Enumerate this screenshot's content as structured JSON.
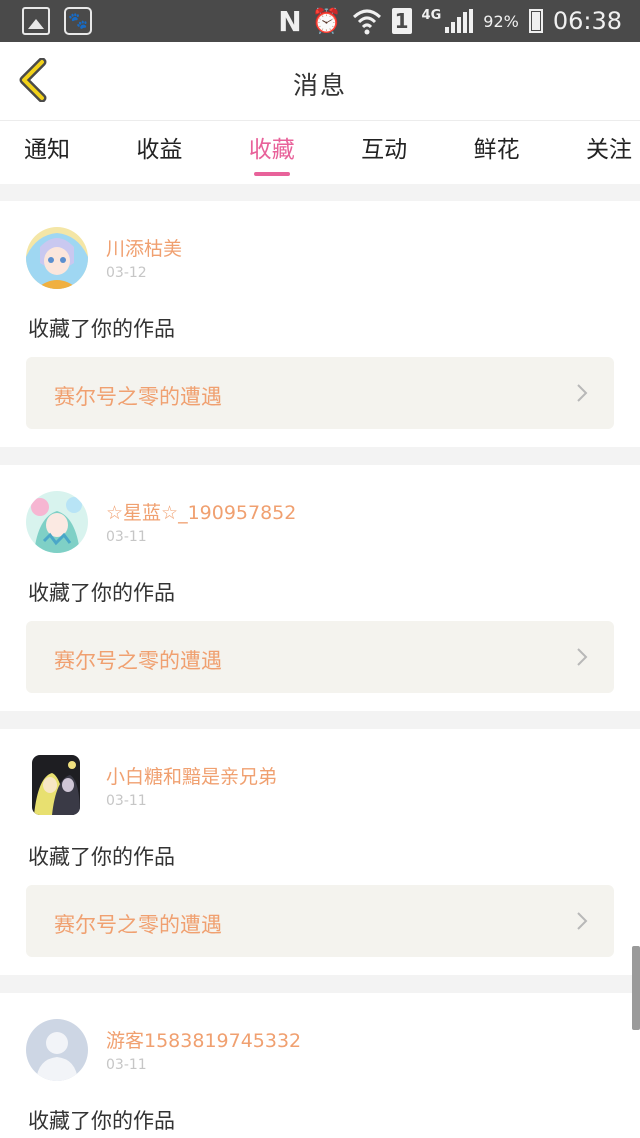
{
  "status_bar": {
    "left_icons": [
      "gallery-icon",
      "paw-icon"
    ],
    "network_letter": "N",
    "sim_slot": "1",
    "network_type": "4G",
    "battery_percent": "92%",
    "time": "06:38"
  },
  "header": {
    "title": "消息",
    "back_icon": "chevron-left-icon"
  },
  "tabs": [
    {
      "label": "通知",
      "active": false
    },
    {
      "label": "收益",
      "active": false
    },
    {
      "label": "收藏",
      "active": true
    },
    {
      "label": "互动",
      "active": false
    },
    {
      "label": "鲜花",
      "active": false
    },
    {
      "label": "关注",
      "active": false
    }
  ],
  "colors": {
    "accent": "#e8629a",
    "name_orange": "#f0a070",
    "work_bg": "#f4f3ee"
  },
  "messages": [
    {
      "username": "川添枯美",
      "date": "03-12",
      "action": "收藏了你的作品",
      "work_title": "赛尔号之零的遭遇"
    },
    {
      "username": "☆星蓝☆_190957852",
      "date": "03-11",
      "action": "收藏了你的作品",
      "work_title": "赛尔号之零的遭遇"
    },
    {
      "username": "小白糖和黯是亲兄弟",
      "date": "03-11",
      "action": "收藏了你的作品",
      "work_title": "赛尔号之零的遭遇"
    },
    {
      "username": "游客1583819745332",
      "date": "03-11",
      "action": "收藏了你的作品"
    }
  ]
}
